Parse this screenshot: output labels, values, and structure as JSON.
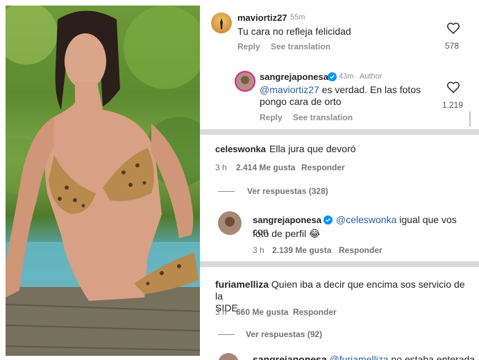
{
  "accent_color": "#0095f6",
  "mention_color": "#2b5ea7",
  "meta_color": "#8e8e8e",
  "photo": {
    "description_icon": "photo"
  },
  "panel1": {
    "comment": {
      "username": "maviortiz27",
      "time": "55m",
      "text": "Tu cara no refleja felicidad",
      "reply": "Reply",
      "translate": "See translation",
      "likes": "578"
    },
    "reply": {
      "username": "sangrejaponesa",
      "time": "43m",
      "dot": "·",
      "role": "Author",
      "mention": "@maviortiz27",
      "text_line1": " es verdad. En las fotos",
      "text_line2": "pongo cara de orto",
      "reply": "Reply",
      "translate": "See translation",
      "likes": "1.219"
    }
  },
  "panel2": {
    "comment": {
      "username": "celeswonka",
      "text": "Ella jura que devoró",
      "time": "3 h",
      "likes": "2.414 Me gusta",
      "reply": "Responder",
      "view_replies": "Ver respuestas (328)"
    },
    "reply": {
      "username": "sangrejaponesa",
      "mention": "@celeswonka",
      "text_line1": " igual que vos con",
      "text_line2": "foto de perfil 😂",
      "time": "3 h",
      "likes": "2.139 Me gusta",
      "reply": "Responder"
    }
  },
  "panel3": {
    "comment": {
      "username": "furiamelliza",
      "text_line1": "Quien iba a decir que encima sos servicio de la",
      "text_line2": "SIDE",
      "time": "3 h",
      "likes": "660 Me gusta",
      "reply": "Responder",
      "view_replies": "Ver respuestas (92)"
    },
    "reply": {
      "username": "sangrejaponesa",
      "mention": "@furiamelliza",
      "text": " no estaba enterada"
    }
  }
}
